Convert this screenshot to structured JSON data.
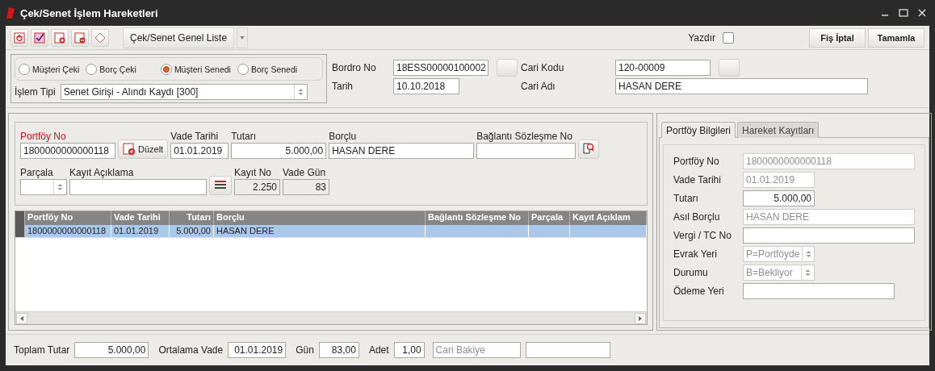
{
  "window": {
    "title": "Çek/Senet İşlem Hareketleri"
  },
  "toolbar": {
    "list_button": "Çek/Senet Genel Liste",
    "print": {
      "label": "Yazdır",
      "checked": false
    },
    "buttons": [
      "Fiş İptal",
      "Tamamla"
    ]
  },
  "document_type": [
    {
      "label": "Müşteri Çeki",
      "selected": false
    },
    {
      "label": "Borç Çeki",
      "selected": false
    },
    {
      "label": "Müşteri Senedi",
      "selected": true
    },
    {
      "label": "Borç Senedi",
      "selected": false
    }
  ],
  "operation": {
    "label": "İşlem Tipi",
    "value": "Senet Girişi - Alındı Kaydı [300]"
  },
  "header_fields": [
    {
      "label": "Bordro No",
      "value": "18ESS00000100002",
      "kind": "lookup"
    },
    {
      "label": "Tarih",
      "value": "10.10.2018",
      "kind": "short"
    },
    {
      "label": "Cari Kodu",
      "value": "120-00009",
      "kind": "lookup"
    },
    {
      "label": "Cari Adı",
      "value": "HASAN DERE",
      "kind": "wide"
    }
  ],
  "entry": {
    "portfolio_no": {
      "label": "Portföy No",
      "value": "1800000000000118",
      "required": true
    },
    "edit_button": "Düzelt",
    "due_date": {
      "label": "Vade Tarihi",
      "value": "01.01.2019"
    },
    "amount": {
      "label": "Tutarı",
      "value": "5.000,00"
    },
    "debtor": {
      "label": "Borçlu",
      "value": "HASAN DERE"
    },
    "contract_no": {
      "label": "Bağlantı Sözleşme No"
    },
    "split": {
      "label": "Parçala"
    },
    "note": {
      "label": "Kayıt Açıklama"
    },
    "record_no": {
      "label": "Kayıt No",
      "value": "2.250"
    },
    "due_days": {
      "label": "Vade Gün",
      "value": "83"
    }
  },
  "table": {
    "columns": [
      "Portföy No",
      "Vade Tarihi",
      "Tutarı",
      "Borçlu",
      "Bağlantı Sözleşme No",
      "Parçala",
      "Kayıt Açıklam"
    ],
    "rows": [
      {
        "cells": [
          "1800000000000118",
          "01.01.2019",
          "5.000,00",
          "HASAN DERE"
        ],
        "selected": true
      }
    ]
  },
  "side_panel": {
    "tabs": [
      {
        "label": "Portföy Bilgileri",
        "selected": true
      },
      {
        "label": "Hareket Kayıtları",
        "selected": false
      }
    ],
    "fields": [
      {
        "label": "Portföy No",
        "value": "1800000000000118",
        "kind": "text",
        "disabled": true
      },
      {
        "label": "Vade Tarihi",
        "value": "01.01.2019",
        "kind": "text",
        "disabled": true
      },
      {
        "label": "Tutarı",
        "value": "5.000,00",
        "kind": "amount",
        "disabled": false
      },
      {
        "label": "Asıl Borçlu",
        "value": "HASAN DERE",
        "kind": "text",
        "disabled": true
      },
      {
        "label": "Vergi / TC No",
        "kind": "text",
        "disabled": false
      },
      {
        "label": "Evrak Yeri",
        "value": "P=Portföyde",
        "kind": "spin",
        "disabled": true
      },
      {
        "label": "Durumu",
        "value": "B=Bekliyor",
        "kind": "spin",
        "disabled": true
      },
      {
        "label": "Ödeme Yeri",
        "kind": "text",
        "disabled": false
      }
    ]
  },
  "footer": {
    "fields": [
      {
        "label": "Toplam Tutar",
        "value": "5.000,00",
        "kind": "amount"
      },
      {
        "label": "Ortalama Vade",
        "value": "01.01.2019",
        "kind": "date"
      },
      {
        "label": "Gün",
        "value": "83,00",
        "kind": "small"
      },
      {
        "label": "Adet",
        "value": "1,00",
        "kind": "tiny"
      }
    ],
    "balance": {
      "placeholder": "Cari Bakiye"
    }
  }
}
